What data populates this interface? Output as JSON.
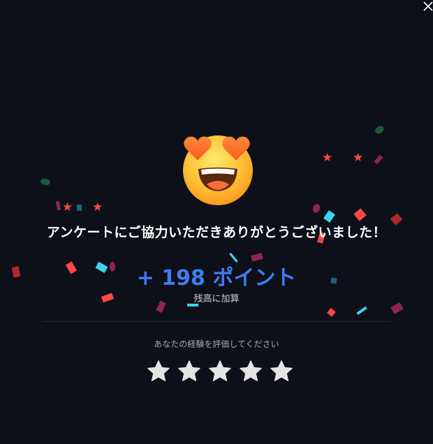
{
  "close_icon": "close-icon",
  "emoji_icon": "heart-eyes-emoji-icon",
  "heading": "アンケートにご協力いただきありがとうございました！",
  "points": {
    "text": "+ 198 ポイント",
    "color": "#3d7cf5"
  },
  "points_sub": "残高に加算",
  "rating": {
    "label": "あなたの経験を評価してください",
    "max_stars": 5,
    "selected": 0,
    "star_icon": "star-icon",
    "star_color": "#e4e4e4"
  },
  "colors": {
    "background": "#0d1019",
    "confetti_red": "#ff4848",
    "confetti_cyan": "#3ad4f0",
    "confetti_magenta": "#8e2452",
    "confetti_teal": "#1c6476",
    "confetti_green": "#1f5a3a"
  }
}
